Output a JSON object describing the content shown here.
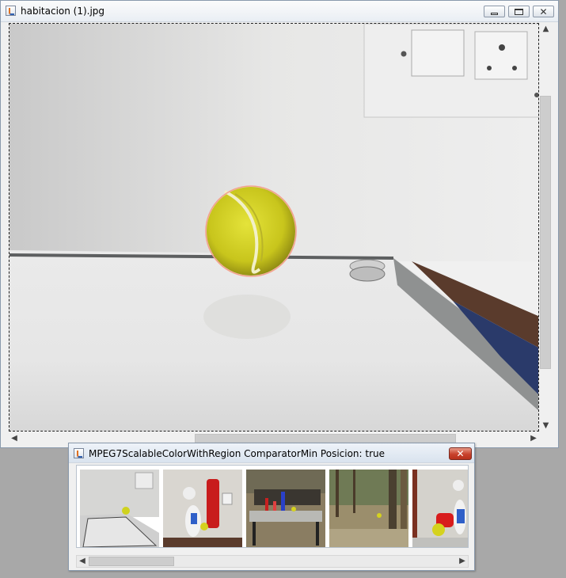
{
  "main_window": {
    "title": "habitacion (1).jpg",
    "title_icon": "java-app-icon",
    "controls": {
      "minimize_icon": "minimize-icon",
      "maximize_icon": "maximize-icon",
      "close_label": "✕"
    },
    "image": {
      "subject": "tennis-ball-on-white-table",
      "overlay_icon": "circle-region-marker"
    },
    "scrollbars": {
      "vertical_up": "▲",
      "vertical_down": "▼",
      "horizontal_left": "◀",
      "horizontal_right": "▶"
    }
  },
  "result_window": {
    "title": "MPEG7ScalableColorWithRegion ComparatorMin Posicion: true",
    "close_label": "✕",
    "thumbnails": [
      {
        "subject": "tennis-ball-on-table-room"
      },
      {
        "subject": "stuffed-toys-and-ball"
      },
      {
        "subject": "bench-outdoor-with-bottles"
      },
      {
        "subject": "forest-path-with-ball"
      },
      {
        "subject": "stuffed-toys-and-ball-2"
      }
    ],
    "scrollbar": {
      "left": "◀",
      "right": "▶"
    }
  },
  "colors": {
    "desktop": "#a8a8a8",
    "window_bg": "#f0f0f0",
    "close_red": "#c8412c",
    "ball_yellow": "#d4d21e"
  }
}
